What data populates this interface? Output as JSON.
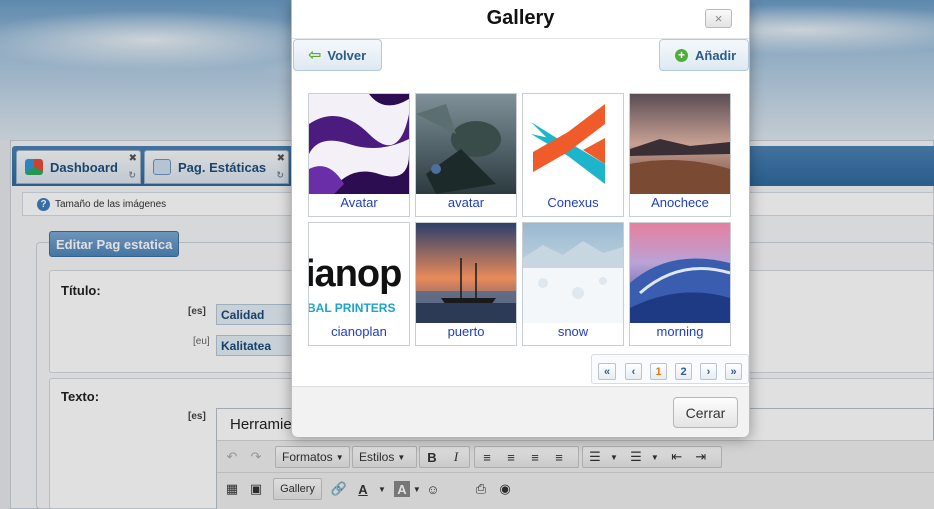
{
  "tabs": [
    {
      "label": "Dashboard",
      "icon": "cubes-icon"
    },
    {
      "label": "Pag. Estáticas",
      "icon": "html-page-icon"
    }
  ],
  "info_bar": {
    "text": "Tamaño de las imágenes"
  },
  "form": {
    "legend": "Editar Pag estatica",
    "titulo": {
      "label": "Título:",
      "rows": [
        {
          "lang": "[es]",
          "value": "Calidad"
        },
        {
          "lang": "[eu]",
          "value": "Kalitatea"
        }
      ]
    },
    "texto": {
      "label": "Texto:",
      "lang": "[es]",
      "editor_menu": "Herramie"
    }
  },
  "toolbar": {
    "formats_label": "Formatos",
    "styles_label": "Estilos",
    "gallery_label": "Gallery"
  },
  "modal": {
    "title": "Gallery",
    "close_glyph": "×",
    "back_label": "Volver",
    "add_label": "Añadir",
    "images": [
      {
        "caption": "Avatar"
      },
      {
        "caption": "avatar"
      },
      {
        "caption": "Conexus"
      },
      {
        "caption": "Anochece"
      },
      {
        "caption": "cianoplan",
        "logo_text_1": "ianop",
        "logo_text_2": "BAL PRINTERS"
      },
      {
        "caption": "puerto"
      },
      {
        "caption": "snow"
      },
      {
        "caption": "morning"
      }
    ],
    "pagination": {
      "first": "«",
      "prev": "‹",
      "pages": [
        "1",
        "2"
      ],
      "current": "1",
      "next": "›",
      "last": "»"
    },
    "footer_button": "Cerrar"
  },
  "colors": {
    "link": "#1d3ec2",
    "accent": "#2f6a9f",
    "current_page": "#e07a10"
  }
}
